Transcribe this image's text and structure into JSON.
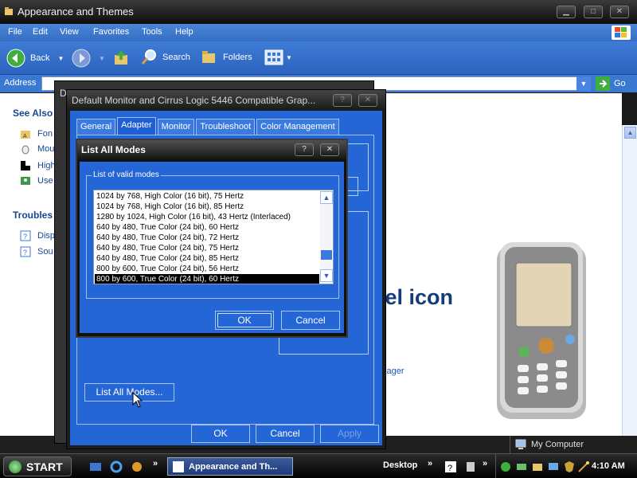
{
  "explorer": {
    "title": "Appearance and Themes",
    "menu": [
      "File",
      "Edit",
      "View",
      "Favorites",
      "Tools",
      "Help"
    ],
    "toolbar": {
      "back": "Back",
      "search": "Search",
      "folders": "Folders"
    },
    "address_label": "Address",
    "go_label": "Go",
    "left_pane": {
      "see_also": "See Also",
      "see_also_items": [
        "Fon",
        "Mou",
        "High",
        "Use"
      ],
      "troubleshooters": "Troubles",
      "troubleshooter_items": [
        "Disp",
        "Sou"
      ]
    },
    "content": {
      "heading_fragment": "nel icon",
      "link_fragment": "kager"
    },
    "status": {
      "my_computer": "My Computer"
    }
  },
  "display_props": {
    "back_title": "D",
    "title": "Default Monitor and Cirrus Logic 5446 Compatible Grap...",
    "tabs": [
      "General",
      "Adapter",
      "Monitor",
      "Troubleshoot",
      "Color Management"
    ],
    "active_tab": "Adapter",
    "list_all_modes_button": "List All Modes...",
    "ok": "OK",
    "cancel": "Cancel",
    "apply": "Apply"
  },
  "list_all_modes": {
    "title": "List All Modes",
    "help": "?",
    "close": "✕",
    "group_label": "List of valid modes",
    "modes": [
      "1024 by 768, High Color (16 bit), 75 Hertz",
      "1024 by 768, High Color (16 bit), 85 Hertz",
      "1280 by 1024, High Color (16 bit), 43 Hertz (Interlaced)",
      "640 by 480, True Color (24 bit), 60 Hertz",
      "640 by 480, True Color (24 bit), 72 Hertz",
      "640 by 480, True Color (24 bit), 75 Hertz",
      "640 by 480, True Color (24 bit), 85 Hertz",
      "800 by 600, True Color (24 bit), 56 Hertz",
      "800 by 600, True Color (24 bit), 60 Hertz"
    ],
    "selected_mode": "800 by 600, True Color (24 bit), 60 Hertz",
    "ok": "OK",
    "cancel": "Cancel"
  },
  "taskbar": {
    "start": "START",
    "task_item": "Appearance and Th...",
    "desktop": "Desktop",
    "chevron": "»",
    "clock": "4:10 AM"
  },
  "colors": {
    "accent": "#2566d6",
    "selection": "#000000",
    "heading": "#123d7a"
  }
}
